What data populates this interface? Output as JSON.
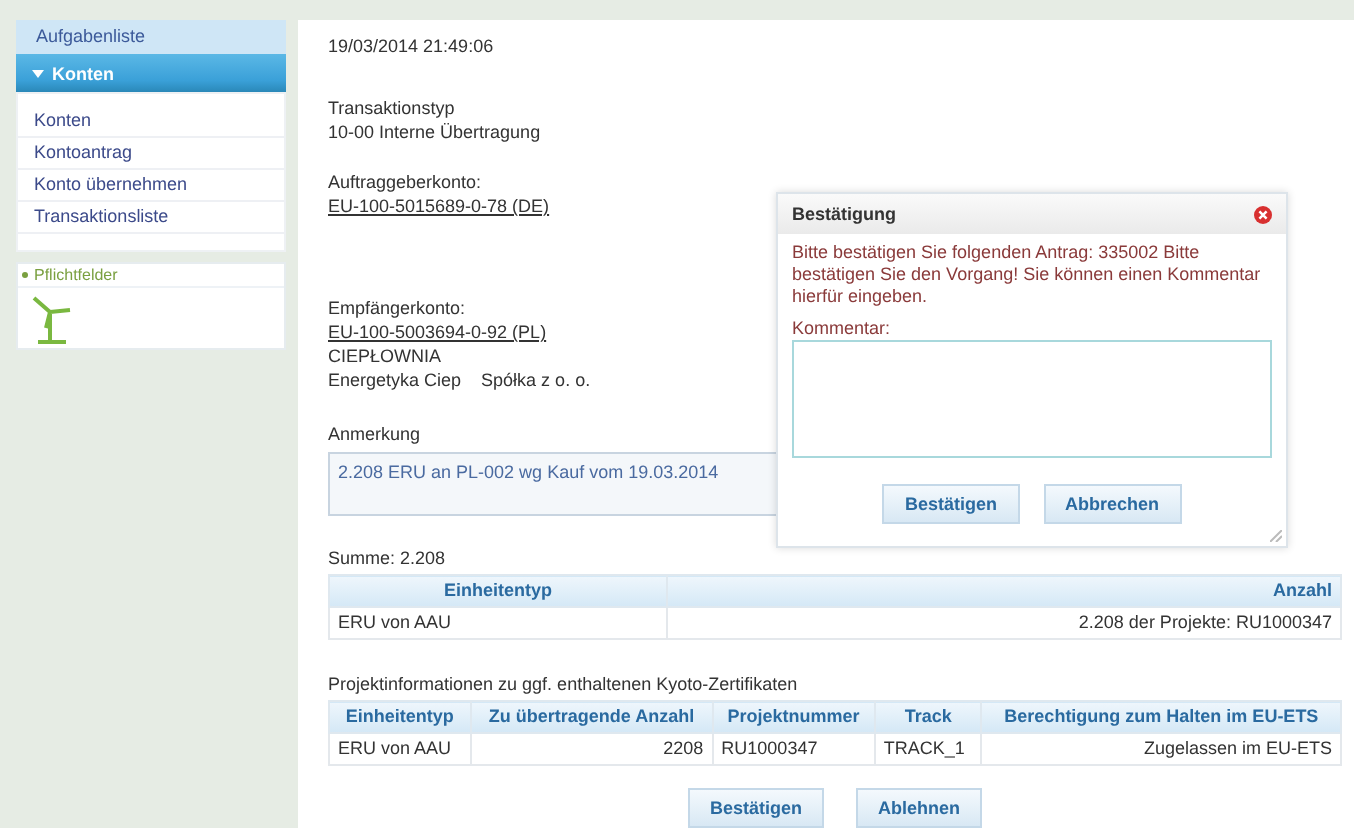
{
  "sidebar": {
    "top_item": "Aufgabenliste",
    "section": {
      "label": "Konten",
      "expanded": true
    },
    "items": [
      "Konten",
      "Kontoantrag",
      "Konto übernehmen",
      "Transaktionsliste"
    ],
    "legend": "Pflichtfelder"
  },
  "details": {
    "date": "19/03/2014 21:49:06",
    "fields": [
      {
        "label": "Transaktionstyp",
        "lines": [
          {
            "text": "10-00 Interne Übertragung",
            "kind": "plain"
          }
        ]
      },
      {
        "label": "Auftraggeberkonto:",
        "lines": [
          {
            "text": "EU-100-5015689-0-78 (DE)",
            "kind": "link"
          }
        ]
      },
      {
        "label": "Empfängerkonto:",
        "lines": [
          {
            "text": "EU-100-5003694-0-92 (PL)",
            "kind": "link"
          },
          {
            "text": "CIEPŁOWNIA",
            "kind": "plain"
          },
          {
            "text": "Energetyka Ciep    Spółka z o. o.",
            "kind": "plain"
          }
        ]
      }
    ],
    "remark_label": "Anmerkung",
    "remark": "2.208 ERU an PL-002 wg Kauf vom 19.03.2014",
    "sum": "Summe: 2.208"
  },
  "summary_table": {
    "columns": [
      "Einheitentyp",
      "Anzahl"
    ],
    "rows": [
      [
        "ERU von AAU",
        "2.208 der Projekte: RU1000347"
      ]
    ]
  },
  "project_caption": "Projektinformationen zu ggf. enthaltenen Kyoto-Zertifikaten",
  "project_table": {
    "columns": [
      "Einheitentyp",
      "Zu übertragende Anzahl",
      "Projektnummer",
      "Track",
      "Berechtigung zum Halten im EU-ETS"
    ],
    "rows": [
      [
        "ERU von AAU",
        "2208",
        "RU1000347",
        "TRACK_1",
        "Zugelassen im EU-ETS"
      ]
    ]
  },
  "buttons": [
    "Bestätigen",
    "Ablehnen"
  ],
  "dialog": {
    "title": "Bestätigung",
    "message": "Bitte bestätigen Sie folgenden Antrag: 335002 Bitte bestätigen Sie den Vorgang! Sie können einen Kommentar hierfür eingeben.",
    "comment_label": "Kommentar:",
    "buttons": [
      "Bestätigen",
      "Abbrechen"
    ]
  }
}
